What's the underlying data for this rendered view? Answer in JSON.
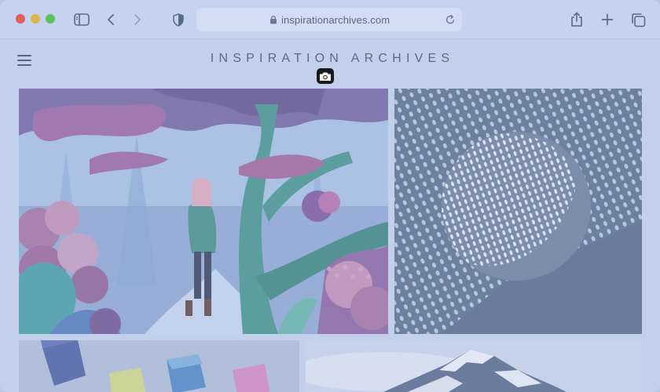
{
  "browser": {
    "url": "inspirationarchives.com",
    "icons": {
      "sidebar": "sidebar-icon",
      "back": "chevron-left-icon",
      "forward": "chevron-right-icon",
      "privacy": "shield-icon",
      "lock": "lock-icon",
      "reload": "reload-icon",
      "share": "share-icon",
      "new_tab": "plus-icon",
      "tab_overview": "tabs-icon"
    }
  },
  "page": {
    "site_title": "INSPIRATION ARCHIVES",
    "icons": {
      "menu": "hamburger-icon",
      "camera": "camera-icon"
    },
    "gallery": [
      {
        "name": "forest-illustration"
      },
      {
        "name": "dotted-sphere"
      },
      {
        "name": "colored-cubes"
      },
      {
        "name": "snowy-mountain"
      }
    ]
  },
  "colors": {
    "window": "#c3d0ec",
    "urlbar": "#d2ddf3",
    "close": "#e2605a",
    "minimize": "#dcb54a",
    "zoom": "#5fbf5f"
  }
}
